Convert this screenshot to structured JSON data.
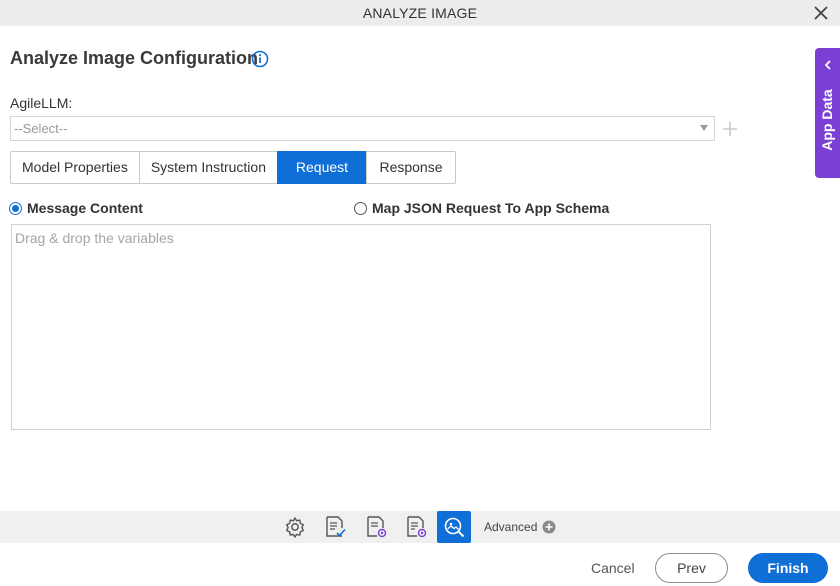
{
  "window": {
    "title": "ANALYZE IMAGE"
  },
  "header": {
    "title": "Analyze Image Configuration"
  },
  "form": {
    "agile_llm_label": "AgileLLM:",
    "agile_llm_value": "--Select--"
  },
  "tabs": [
    {
      "label": "Model Properties",
      "active": false
    },
    {
      "label": "System Instruction",
      "active": false
    },
    {
      "label": "Request",
      "active": true
    },
    {
      "label": "Response",
      "active": false
    }
  ],
  "request": {
    "option_message_content": "Message Content",
    "option_map_json": "Map JSON Request To App Schema",
    "selected": "Message Content",
    "textarea_placeholder": "Drag & drop the variables"
  },
  "side_panel": {
    "label": "App Data"
  },
  "toolbar": {
    "icons": [
      "settings-icon",
      "document-check-icon",
      "document-gear-icon",
      "document-settings-icon",
      "image-search-icon"
    ],
    "active_icon": "image-search-icon",
    "advanced_label": "Advanced"
  },
  "footer": {
    "cancel_label": "Cancel",
    "prev_label": "Prev",
    "finish_label": "Finish"
  },
  "colors": {
    "accent": "#0f6fd6",
    "side_panel": "#7b3fd4",
    "titlebar": "#ececec"
  }
}
